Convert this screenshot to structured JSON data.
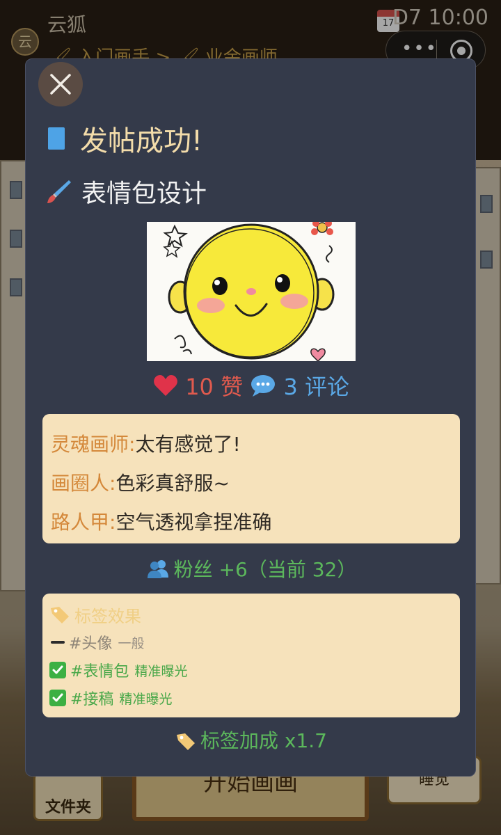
{
  "background": {
    "app_title": "云狐",
    "avatar_char": "云",
    "status_text": "🖌 入门画手 > 🖌 业余画师",
    "day_clock": "D7 10:00",
    "calendar": {
      "month": "JUL",
      "day": "17"
    },
    "capsule_more": "•••",
    "folder_label": "文件夹",
    "start_label": "开始画画",
    "sleep_label": "睡觉"
  },
  "modal": {
    "success_title": "发帖成功!",
    "subject_title": "表情包设计",
    "artwork_icon": "sun-smiley-drawing",
    "likes_text": "10 赞",
    "comments_text": "3 评论",
    "comments": [
      {
        "author": "灵魂画师: ",
        "text": "太有感觉了!"
      },
      {
        "author": "画圈人: ",
        "text": "色彩真舒服~"
      },
      {
        "author": "路人甲: ",
        "text": "空气透视拿捏准确"
      }
    ],
    "fans_text": "粉丝 +6（当前 32）",
    "tags_title": "标签效果",
    "tags": [
      {
        "name": "#头像",
        "effect": "一般",
        "status": "neutral"
      },
      {
        "name": "#表情包",
        "effect": "精准曝光",
        "status": "good"
      },
      {
        "name": "#接稿",
        "effect": "精准曝光",
        "status": "good"
      }
    ],
    "bonus_text": "标签加成 x1.7"
  },
  "colors": {
    "modal_bg": "#343a4a",
    "card_bg": "#f6e2bb",
    "title_gold": "#f3dcaa",
    "like_red": "#e05a4e",
    "comment_blue": "#5aa8e6",
    "good_green": "#4aa84a"
  }
}
